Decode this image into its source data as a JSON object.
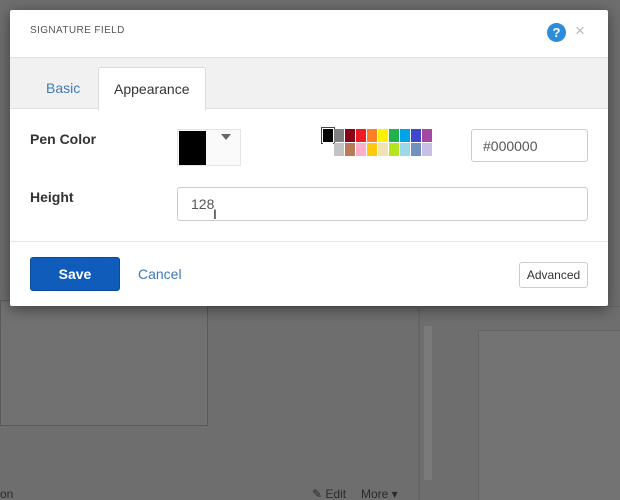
{
  "dialog": {
    "title": "SIGNATURE FIELD",
    "help_icon": "help-icon",
    "close_icon": "close-icon",
    "help_glyph": "?",
    "close_glyph": "×"
  },
  "tabs": [
    {
      "label": "Basic",
      "active": false
    },
    {
      "label": "Appearance",
      "active": true
    }
  ],
  "pen_color": {
    "label": "Pen Color",
    "selected_color": "#000000",
    "hex_value": "#000000",
    "palette_row1": [
      "#000000",
      "#7f7f7f",
      "#880015",
      "#ed1c24",
      "#ff7f27",
      "#fff200",
      "#22b14c",
      "#00a2e8",
      "#3f48cc",
      "#a349a4"
    ],
    "palette_row2": [
      "#ffffff",
      "#c3c3c3",
      "#b97a57",
      "#ffaec9",
      "#ffc90e",
      "#efe4b0",
      "#b5e61d",
      "#99d9ea",
      "#7092be",
      "#c8bfe7"
    ]
  },
  "height": {
    "label": "Height",
    "value": "128"
  },
  "footer": {
    "save_label": "Save",
    "cancel_label": "Cancel",
    "advanced_label": "Advanced"
  },
  "background": {
    "edit_label": "✎ Edit",
    "more_label": "More ▾",
    "frag_left": "on"
  },
  "colors": {
    "primary_button": "#0f5cba",
    "link": "#3d7ab8",
    "help_badge": "#2b8ddb"
  }
}
